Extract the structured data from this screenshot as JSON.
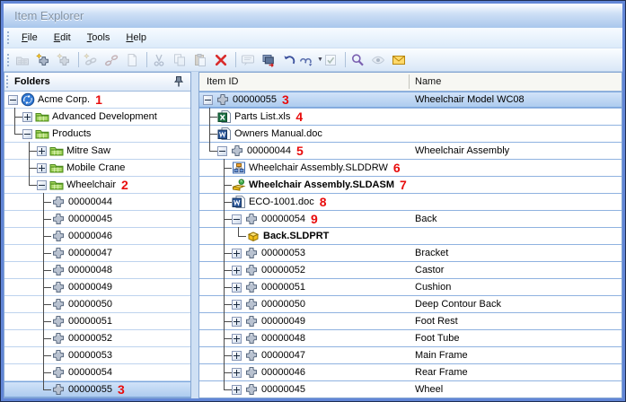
{
  "window": {
    "title": "Item Explorer"
  },
  "menu": {
    "items": [
      {
        "label": "File"
      },
      {
        "label": "Edit"
      },
      {
        "label": "Tools"
      },
      {
        "label": "Help"
      }
    ]
  },
  "toolbar": {
    "buttons": [
      {
        "icon": "new-folder-icon",
        "enabled": false
      },
      {
        "icon": "new-item-icon",
        "enabled": true
      },
      {
        "icon": "copy-item-icon",
        "enabled": false
      },
      {
        "sep": true
      },
      {
        "icon": "new-link-icon",
        "enabled": false
      },
      {
        "icon": "break-link-icon",
        "enabled": false
      },
      {
        "icon": "new-document-icon",
        "enabled": false
      },
      {
        "sep": true
      },
      {
        "icon": "cut-icon",
        "enabled": false
      },
      {
        "icon": "copy-icon",
        "enabled": false
      },
      {
        "icon": "paste-icon",
        "enabled": false
      },
      {
        "icon": "delete-icon",
        "enabled": true
      },
      {
        "sep": true
      },
      {
        "icon": "comments-icon",
        "enabled": false
      },
      {
        "icon": "check-in-icon",
        "enabled": true
      },
      {
        "icon": "undo-icon",
        "enabled": true
      },
      {
        "icon": "redo-icon",
        "enabled": true,
        "dropdown": true
      },
      {
        "icon": "validate-icon",
        "enabled": false
      },
      {
        "sep": true
      },
      {
        "icon": "search-icon",
        "enabled": true
      },
      {
        "icon": "preview-icon",
        "enabled": false
      },
      {
        "icon": "email-icon",
        "enabled": true
      }
    ]
  },
  "folders_panel": {
    "header": "Folders",
    "rows": [
      {
        "indent": [],
        "expand": "minus",
        "icon": "vault",
        "label": "Acme Corp.",
        "ann": "1"
      },
      {
        "indent": [
          "t"
        ],
        "expand": "plus",
        "icon": "folder",
        "label": "Advanced Development"
      },
      {
        "indent": [
          "e"
        ],
        "expand": "minus",
        "icon": "folder",
        "label": "Products"
      },
      {
        "indent": [
          "b",
          "t"
        ],
        "expand": "plus",
        "icon": "folder",
        "label": "Mitre Saw"
      },
      {
        "indent": [
          "b",
          "t"
        ],
        "expand": "plus",
        "icon": "folder",
        "label": "Mobile Crane"
      },
      {
        "indent": [
          "b",
          "e"
        ],
        "expand": "minus",
        "icon": "folder",
        "label": "Wheelchair",
        "ann": "2"
      },
      {
        "indent": [
          "b",
          "b",
          "t"
        ],
        "icon": "item",
        "label": "00000044"
      },
      {
        "indent": [
          "b",
          "b",
          "t"
        ],
        "icon": "item",
        "label": "00000045"
      },
      {
        "indent": [
          "b",
          "b",
          "t"
        ],
        "icon": "item",
        "label": "00000046"
      },
      {
        "indent": [
          "b",
          "b",
          "t"
        ],
        "icon": "item",
        "label": "00000047"
      },
      {
        "indent": [
          "b",
          "b",
          "t"
        ],
        "icon": "item",
        "label": "00000048"
      },
      {
        "indent": [
          "b",
          "b",
          "t"
        ],
        "icon": "item",
        "label": "00000049"
      },
      {
        "indent": [
          "b",
          "b",
          "t"
        ],
        "icon": "item",
        "label": "00000050"
      },
      {
        "indent": [
          "b",
          "b",
          "t"
        ],
        "icon": "item",
        "label": "00000051"
      },
      {
        "indent": [
          "b",
          "b",
          "t"
        ],
        "icon": "item",
        "label": "00000052"
      },
      {
        "indent": [
          "b",
          "b",
          "t"
        ],
        "icon": "item",
        "label": "00000053"
      },
      {
        "indent": [
          "b",
          "b",
          "t"
        ],
        "icon": "item",
        "label": "00000054"
      },
      {
        "indent": [
          "b",
          "b",
          "e"
        ],
        "icon": "item",
        "label": "00000055",
        "ann": "3",
        "selected": true
      }
    ]
  },
  "items_panel": {
    "columns": {
      "item_id": "Item ID",
      "name": "Name"
    },
    "rows": [
      {
        "indent": [],
        "expand": "minus",
        "icon": "item",
        "label": "00000055",
        "ann": "3",
        "name": "Wheelchair Model WC08",
        "selected": true
      },
      {
        "indent": [
          "t"
        ],
        "icon": "excel",
        "label": "Parts List.xls",
        "ann": "4"
      },
      {
        "indent": [
          "t"
        ],
        "icon": "word",
        "label": "Owners Manual.doc"
      },
      {
        "indent": [
          "e"
        ],
        "expand": "minus",
        "icon": "item",
        "label": "00000044",
        "ann": "5",
        "name": "Wheelchair Assembly"
      },
      {
        "indent": [
          "b",
          "t"
        ],
        "icon": "drawing",
        "label": "Wheelchair Assembly.SLDDRW",
        "ann": "6"
      },
      {
        "indent": [
          "b",
          "t"
        ],
        "icon": "assembly",
        "label": "Wheelchair Assembly.SLDASM",
        "ann": "7",
        "bold": true
      },
      {
        "indent": [
          "b",
          "t"
        ],
        "icon": "word",
        "label": "ECO-1001.doc",
        "ann": "8"
      },
      {
        "indent": [
          "b",
          "t"
        ],
        "expand": "minus",
        "icon": "item",
        "label": "00000054",
        "ann": "9",
        "name": "Back"
      },
      {
        "indent": [
          "b",
          "v",
          "e"
        ],
        "icon": "part",
        "label": "Back.SLDPRT",
        "bold": true
      },
      {
        "indent": [
          "b",
          "t"
        ],
        "expand": "plus",
        "icon": "item",
        "label": "00000053",
        "name": "Bracket"
      },
      {
        "indent": [
          "b",
          "t"
        ],
        "expand": "plus",
        "icon": "item",
        "label": "00000052",
        "name": "Castor"
      },
      {
        "indent": [
          "b",
          "t"
        ],
        "expand": "plus",
        "icon": "item",
        "label": "00000051",
        "name": "Cushion"
      },
      {
        "indent": [
          "b",
          "t"
        ],
        "expand": "plus",
        "icon": "item",
        "label": "00000050",
        "name": "Deep Contour Back"
      },
      {
        "indent": [
          "b",
          "t"
        ],
        "expand": "plus",
        "icon": "item",
        "label": "00000049",
        "name": "Foot Rest"
      },
      {
        "indent": [
          "b",
          "t"
        ],
        "expand": "plus",
        "icon": "item",
        "label": "00000048",
        "name": "Foot Tube"
      },
      {
        "indent": [
          "b",
          "t"
        ],
        "expand": "plus",
        "icon": "item",
        "label": "00000047",
        "name": "Main Frame"
      },
      {
        "indent": [
          "b",
          "t"
        ],
        "expand": "plus",
        "icon": "item",
        "label": "00000046",
        "name": "Rear Frame"
      },
      {
        "indent": [
          "b",
          "e"
        ],
        "expand": "plus",
        "icon": "item",
        "label": "00000045",
        "name": "Wheel"
      }
    ]
  },
  "colors": {
    "selection": "#abcaee",
    "annotation": "#e80c0c",
    "grid_line_right": "#8fb2e0",
    "grid_line_left": "#bed3ee",
    "frame": "#6286d6"
  }
}
